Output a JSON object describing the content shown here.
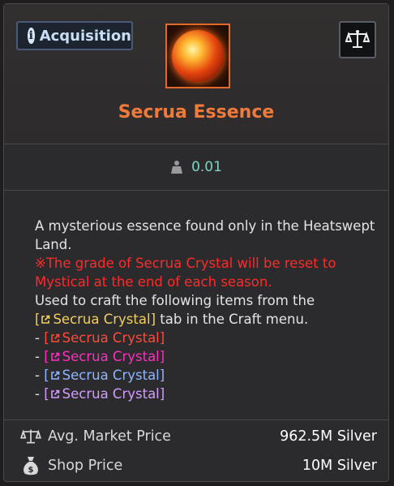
{
  "header": {
    "acquisition_label": "Acquisition",
    "item_name": "Secrua Essence"
  },
  "weight": {
    "value": "0.01"
  },
  "description": {
    "line1": "A mysterious essence found only in the Heatswept Land.",
    "warning": "※The grade of Secrua Crystal will be reset to Mystical at the end of each season.",
    "craft_intro": "Used to craft the following items from the",
    "craft_link": "Secrua Crystal",
    "craft_suffix": "tab in the Craft menu.",
    "items": [
      {
        "label": "Secrua Crystal",
        "color": "#ff4a3a"
      },
      {
        "label": "Secrua Crystal",
        "color": "#ff2fbf"
      },
      {
        "label": "Secrua Crystal",
        "color": "#8fb6ff"
      },
      {
        "label": "Secrua Crystal",
        "color": "#d59bff"
      }
    ]
  },
  "footer": {
    "market_label": "Avg. Market Price",
    "market_value": "962.5M Silver",
    "shop_label": "Shop Price",
    "shop_value": "10M Silver"
  },
  "colors": {
    "title": "#f07a3a",
    "warning": "#ff2a2a",
    "link": "#f2cf5b",
    "weight": "#7fd3c6"
  }
}
